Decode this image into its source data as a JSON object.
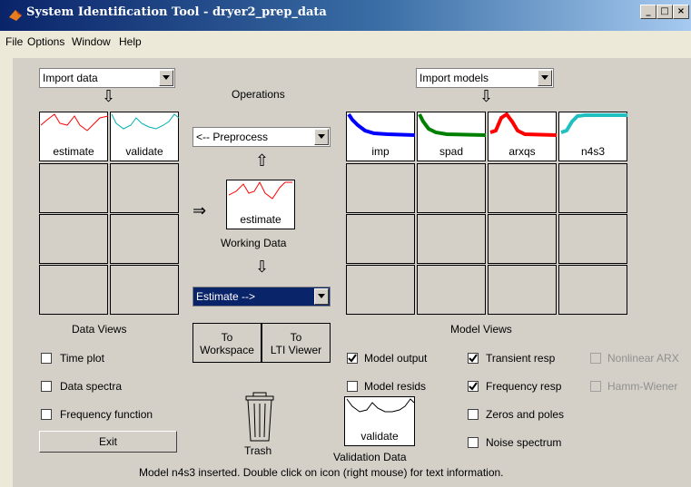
{
  "window": {
    "title": "System Identification Tool - dryer2_prep_data"
  },
  "menu": [
    "File",
    "Options",
    "Window",
    "Help"
  ],
  "import_data": "Import data",
  "import_models": "Import models",
  "operations_label": "Operations",
  "preprocess": "<-- Preprocess",
  "working_data": {
    "name": "estimate",
    "label": "Working Data"
  },
  "estimate_menu": "Estimate -->",
  "data_boards": [
    {
      "label": "estimate",
      "color": "#ff0000"
    },
    {
      "label": "validate",
      "color": "#00b0b0"
    }
  ],
  "model_boards": [
    {
      "label": "imp",
      "color": "#0000ff"
    },
    {
      "label": "spad",
      "color": "#008000"
    },
    {
      "label": "arxqs",
      "color": "#ff0000"
    },
    {
      "label": "n4s3",
      "color": "#20c0c0"
    }
  ],
  "data_views": {
    "title": "Data Views",
    "items": [
      {
        "label": "Time plot",
        "checked": false
      },
      {
        "label": "Data spectra",
        "checked": false
      },
      {
        "label": "Frequency function",
        "checked": false
      }
    ]
  },
  "exit": "Exit",
  "to_workspace": [
    "To",
    "Workspace"
  ],
  "to_lti": [
    "To",
    "LTI Viewer"
  ],
  "trash": "Trash",
  "validation": {
    "name": "validate",
    "label": "Validation Data"
  },
  "model_views": {
    "title": "Model Views",
    "items": [
      {
        "label": "Model output",
        "checked": true,
        "enabled": true
      },
      {
        "label": "Model resids",
        "checked": false,
        "enabled": true
      },
      {
        "label": "Transient resp",
        "checked": true,
        "enabled": true
      },
      {
        "label": "Frequency resp",
        "checked": true,
        "enabled": true
      },
      {
        "label": "Zeros and poles",
        "checked": false,
        "enabled": true
      },
      {
        "label": "Noise spectrum",
        "checked": false,
        "enabled": true
      },
      {
        "label": "Nonlinear ARX",
        "checked": false,
        "enabled": false
      },
      {
        "label": "Hamm-Wiener",
        "checked": false,
        "enabled": false
      }
    ]
  },
  "status": "Model n4s3 inserted.  Double click on icon (right mouse) for text information."
}
